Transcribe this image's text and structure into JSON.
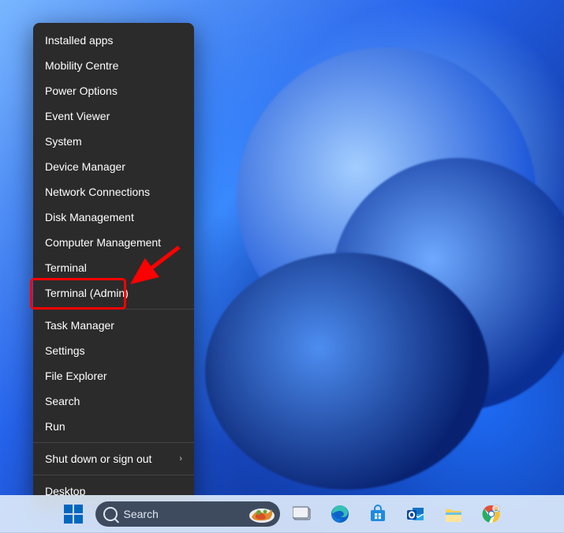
{
  "menu": {
    "groups": [
      [
        "Installed apps",
        "Mobility Centre",
        "Power Options",
        "Event Viewer",
        "System",
        "Device Manager",
        "Network Connections",
        "Disk Management",
        "Computer Management",
        "Terminal",
        "Terminal (Admin)"
      ],
      [
        "Task Manager",
        "Settings",
        "File Explorer",
        "Search",
        "Run"
      ],
      [
        "Shut down or sign out"
      ],
      [
        "Desktop"
      ]
    ],
    "submenu_items": [
      "Shut down or sign out"
    ],
    "highlighted_item": "Terminal (Admin)"
  },
  "taskbar": {
    "search_placeholder": "Search",
    "apps": [
      {
        "id": "task-view",
        "title": "Task View"
      },
      {
        "id": "edge",
        "title": "Microsoft Edge"
      },
      {
        "id": "store",
        "title": "Microsoft Store"
      },
      {
        "id": "outlook",
        "title": "Outlook"
      },
      {
        "id": "file-explorer",
        "title": "File Explorer"
      },
      {
        "id": "chrome",
        "title": "Google Chrome"
      }
    ]
  },
  "annotation": {
    "arrow_target": "Terminal (Admin)",
    "arrow_color": "#ff0000"
  }
}
